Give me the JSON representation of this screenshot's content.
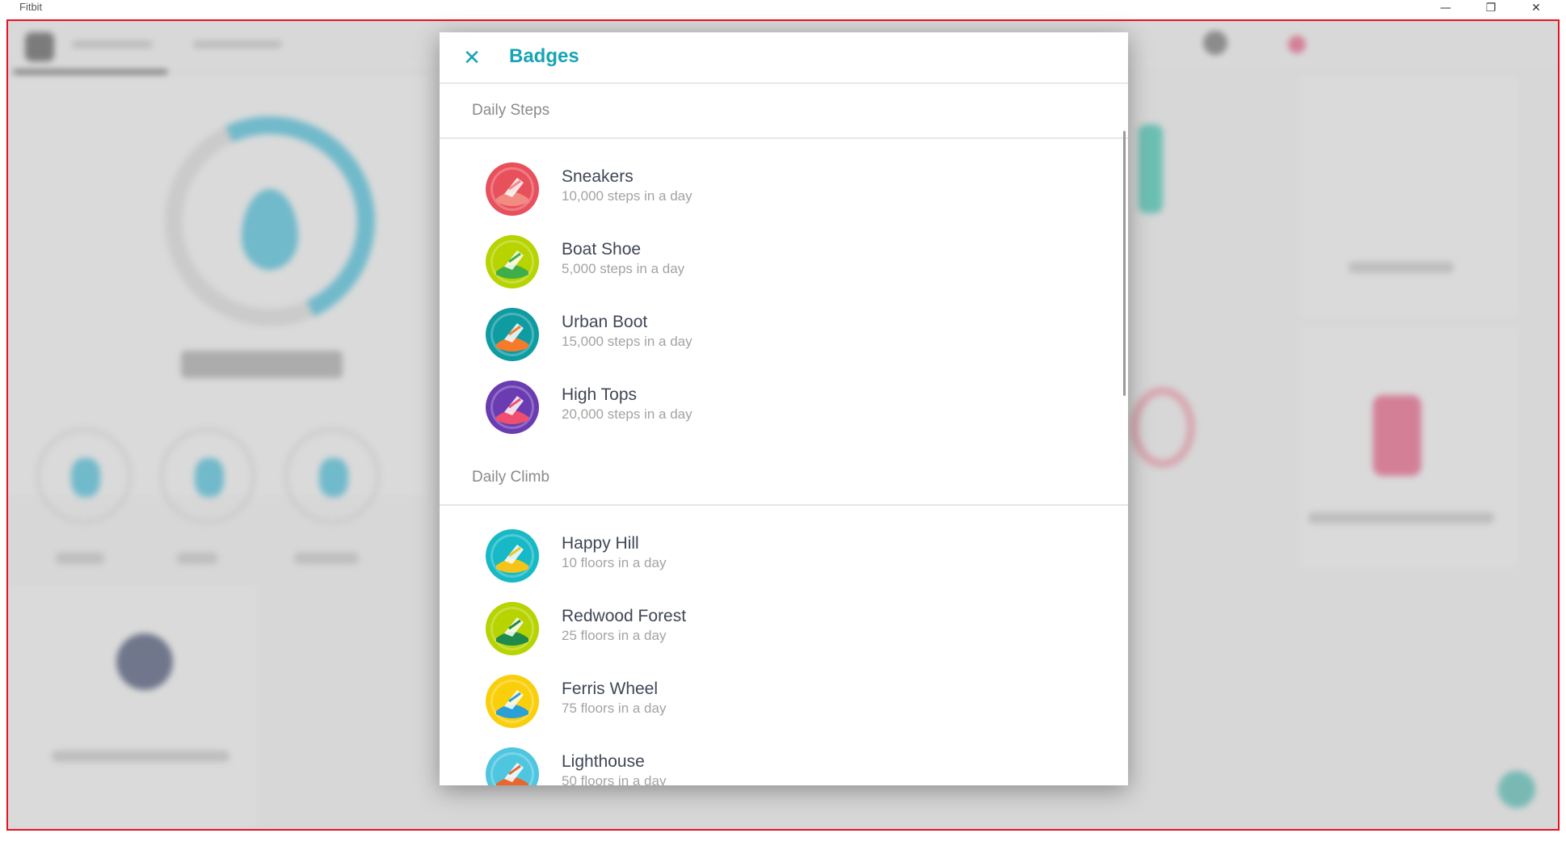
{
  "window": {
    "title": "Fitbit",
    "controls": {
      "minimize": "—",
      "maximize": "❐",
      "close": "✕"
    }
  },
  "modal": {
    "title": "Badges",
    "close_icon": "close-icon",
    "accent_color": "#18a4b6",
    "sections": [
      {
        "title": "Daily Steps",
        "badges": [
          {
            "name": "Sneakers",
            "description": "10,000 steps in a day",
            "icon": "sneakers-badge-icon",
            "colors": [
              "#e8505c",
              "#f28b82"
            ]
          },
          {
            "name": "Boat Shoe",
            "description": "5,000 steps in a day",
            "icon": "boat-shoe-badge-icon",
            "colors": [
              "#b7d300",
              "#3fae49"
            ]
          },
          {
            "name": "Urban Boot",
            "description": "15,000 steps in a day",
            "icon": "urban-boot-badge-icon",
            "colors": [
              "#0f9ba2",
              "#f57b2a"
            ]
          },
          {
            "name": "High Tops",
            "description": "20,000 steps in a day",
            "icon": "high-tops-badge-icon",
            "colors": [
              "#6a3bb1",
              "#f04e6e"
            ]
          }
        ]
      },
      {
        "title": "Daily Climb",
        "badges": [
          {
            "name": "Happy Hill",
            "description": "10 floors in a day",
            "icon": "happy-hill-badge-icon",
            "colors": [
              "#17b9c6",
              "#f6c419"
            ]
          },
          {
            "name": "Redwood Forest",
            "description": "25 floors in a day",
            "icon": "redwood-forest-badge-icon",
            "colors": [
              "#b7d300",
              "#1e8a4c"
            ]
          },
          {
            "name": "Ferris Wheel",
            "description": "75 floors in a day",
            "icon": "ferris-wheel-badge-icon",
            "colors": [
              "#f9cf0c",
              "#2a9fd8"
            ]
          },
          {
            "name": "Lighthouse",
            "description": "50 floors in a day",
            "icon": "lighthouse-badge-icon",
            "colors": [
              "#4fc6e0",
              "#e9662c"
            ]
          }
        ]
      }
    ]
  }
}
